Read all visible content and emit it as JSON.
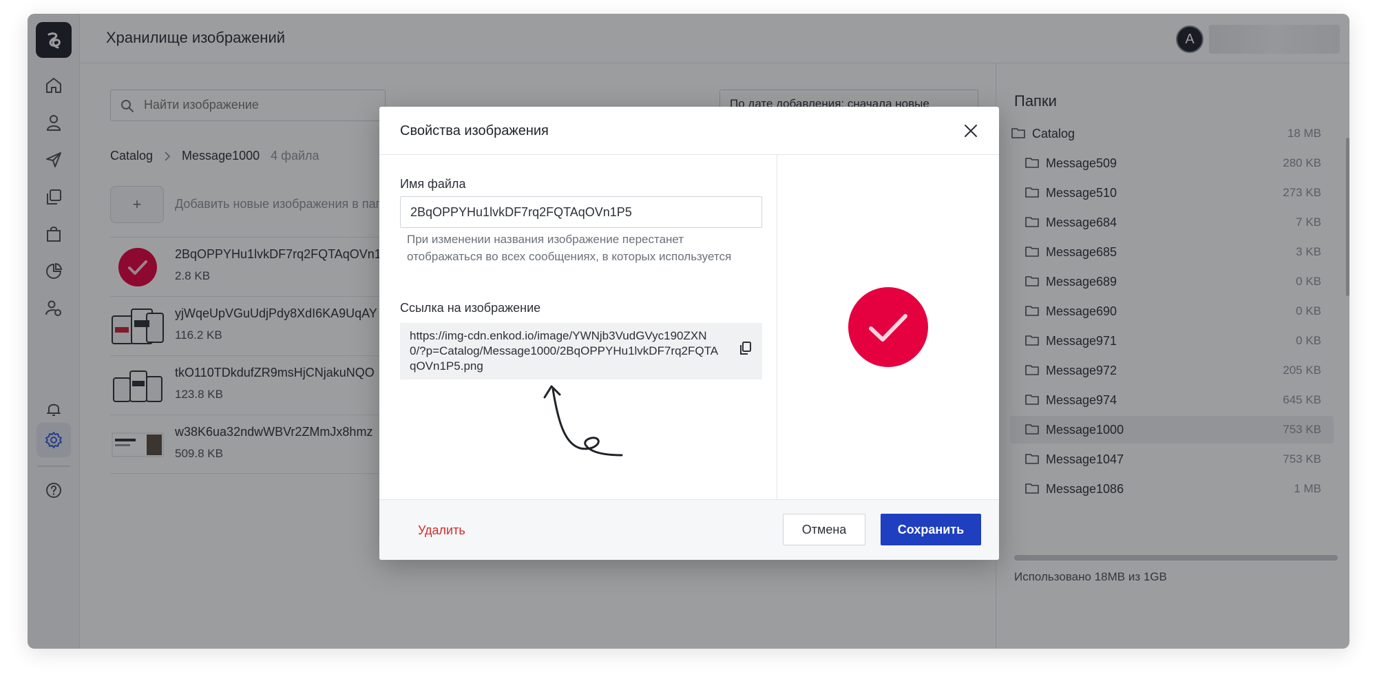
{
  "header": {
    "title": "Хранилище изображений",
    "avatar_letter": "A"
  },
  "colors": {
    "accent": "#1e3fbf",
    "danger": "#d42a2a",
    "brand_red": "#e5003f"
  },
  "main": {
    "search_placeholder": "Найти изображение",
    "sort_label": "По дате добавления: сначала новые",
    "breadcrumb": {
      "root": "Catalog",
      "current": "Message1000",
      "count": "4 файла"
    },
    "add_button": "+",
    "add_text": "Добавить новые изображения в папку",
    "files": [
      {
        "name": "2BqOPPYHu1lvkDF7rq2FQTAqOVn1P5",
        "size": "2.8 KB"
      },
      {
        "name": "yjWqeUpVGuUdjPdy8XdI6KA9UqAY",
        "size": "116.2 KB"
      },
      {
        "name": "tkO110TDkdufZR9msHjCNjakuNQO",
        "size": "123.8 KB"
      },
      {
        "name": "w38K6ua32ndwWBVr2ZMmJx8hmz",
        "size": "509.8 KB"
      }
    ]
  },
  "folders": {
    "title": "Папки",
    "items": [
      {
        "name": "Catalog",
        "size": "18 MB"
      },
      {
        "name": "Message509",
        "size": "280 KB"
      },
      {
        "name": "Message510",
        "size": "273 KB"
      },
      {
        "name": "Message684",
        "size": "7 KB"
      },
      {
        "name": "Message685",
        "size": "3 KB"
      },
      {
        "name": "Message689",
        "size": "0 KB"
      },
      {
        "name": "Message690",
        "size": "0 KB"
      },
      {
        "name": "Message971",
        "size": "0 KB"
      },
      {
        "name": "Message972",
        "size": "205 KB"
      },
      {
        "name": "Message974",
        "size": "645 KB"
      },
      {
        "name": "Message1000",
        "size": "753 KB"
      },
      {
        "name": "Message1047",
        "size": "753 KB"
      },
      {
        "name": "Message1086",
        "size": "1 MB"
      }
    ],
    "usage": "Использовано 18MB из 1GB"
  },
  "modal": {
    "title": "Свойства изображения",
    "filename_label": "Имя файла",
    "filename_value": "2BqOPPYHu1lvkDF7rq2FQTAqOVn1P5",
    "filename_hint": "При изменении названия изображение перестанет отображаться во всех сообщениях, в которых используется",
    "link_label": "Ссылка на изображение",
    "link_value": "https://img-cdn.enkod.io/image/YWNjb3VudGVyc190ZXN0/?p=Catalog/Message1000/2BqOPPYHu1lvkDF7rq2FQTAqOVn1P5.png",
    "delete_label": "Удалить",
    "cancel_label": "Отмена",
    "save_label": "Сохранить"
  }
}
